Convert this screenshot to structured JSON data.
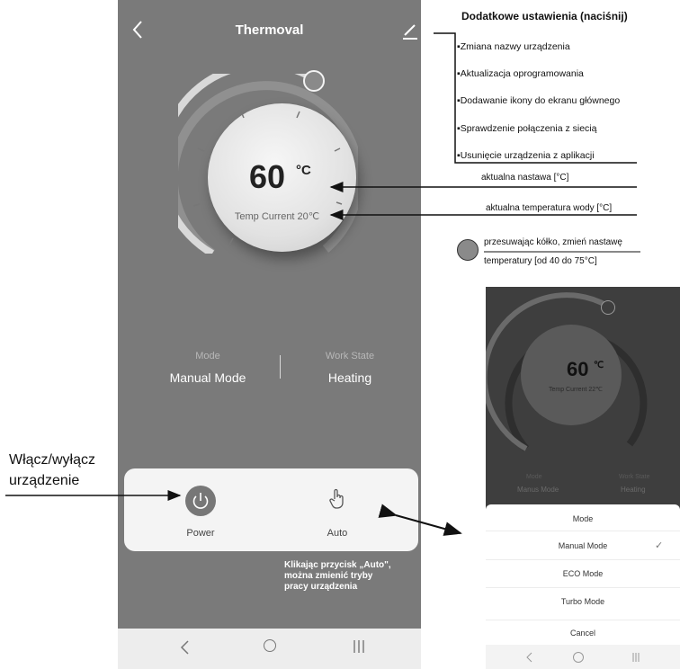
{
  "app": {
    "title": "Thermoval",
    "setpoint": "60",
    "setpoint_unit": "°C",
    "temp_current": "Temp Current 20℃",
    "mode_label": "Mode",
    "mode_value": "Manual Mode",
    "work_state_label": "Work State",
    "work_state_value": "Heating",
    "power_label": "Power",
    "auto_label": "Auto",
    "icons": {
      "back": "chevron-left-icon",
      "edit": "pencil-icon",
      "power": "power-icon",
      "auto": "hand-pointer-icon"
    }
  },
  "settings": {
    "title": "Dodatkowe ustawienia (naciśnij)",
    "items": [
      "▪Zmiana nazwy urządzenia",
      "▪Aktualizacja  oprogramowania",
      "▪Dodawanie ikony do ekranu głównego",
      "▪Sprawdzenie połączenia z siecią",
      "▪Usunięcie urządzenia z aplikacji"
    ]
  },
  "annotations": {
    "setpoint_note": "aktualna nastawa [°C]",
    "water_temp_note": "aktualna temperatura wody [°C]",
    "knob_note_line1": "przesuwając kółko, zmień nastawę",
    "knob_note_line2": "temperatury [od 40 do 75°C]",
    "power_note_line1": "Włącz/wyłącz",
    "power_note_line2": "urządzenie",
    "auto_note_line1": "Klikając przycisk „Auto\",",
    "auto_note_line2": "można zmienić tryby",
    "auto_note_line3": "pracy urządzenia"
  },
  "preview": {
    "setpoint": "60",
    "setpoint_unit": "℃",
    "temp_current": "Temp Current 22℃",
    "mode_label": "Mode",
    "mode_value": "Manus Mode",
    "work_state_label": "Work State",
    "work_state_value": "Heating",
    "sheet": {
      "title": "Mode",
      "options": [
        "Manual Mode",
        "ECO Mode",
        "Turbo Mode"
      ],
      "selected": "Manual Mode",
      "cancel": "Cancel"
    }
  },
  "colors": {
    "phone_bg": "#7a7a7a",
    "knob": "#8a8a8a",
    "card_bg": "#f4f4f4"
  }
}
